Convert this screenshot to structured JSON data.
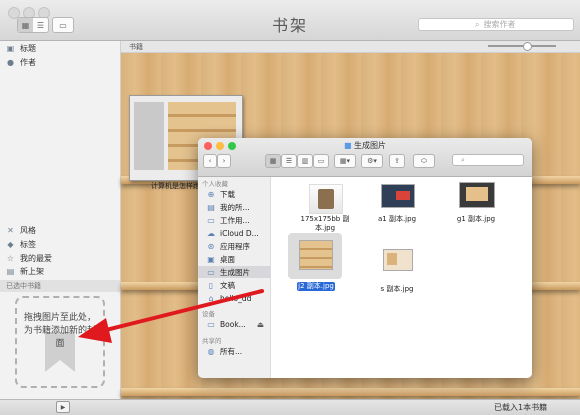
{
  "app": {
    "title": "书架"
  },
  "toolbar": {
    "view_grid_icon": "grid-view-icon",
    "view_list_icon": "list-view-icon",
    "view_cover_icon": "coverflow-view-icon",
    "search_placeholder": "搜索作者"
  },
  "sidebar": {
    "items": [
      {
        "label": "标题",
        "icon": "book-icon"
      },
      {
        "label": "作者",
        "icon": "person-icon"
      }
    ],
    "lower_items": [
      {
        "label": "风格",
        "icon": "tools-icon"
      },
      {
        "label": "标签",
        "icon": "tag-icon"
      },
      {
        "label": "我的最爱",
        "icon": "star-icon"
      },
      {
        "label": "新上架",
        "icon": "new-book-icon"
      }
    ],
    "selected_header": "已选中书籍",
    "drop_hint": "拖拽图片至此处，为书籍添加新的封面"
  },
  "main": {
    "column_header": "书籍",
    "book_label": "计算机是怎样跑起来的"
  },
  "bottom": {
    "status": "已载入1本书籍"
  },
  "finder": {
    "title": "生成图片",
    "sidebar": {
      "favorites_header": "个人收藏",
      "favorites": [
        {
          "label": "下载",
          "icon": "download-icon"
        },
        {
          "label": "我的所...",
          "icon": "files-icon"
        },
        {
          "label": "工作用...",
          "icon": "folder-icon"
        },
        {
          "label": "iCloud D...",
          "icon": "cloud-icon"
        },
        {
          "label": "应用程序",
          "icon": "apps-icon"
        },
        {
          "label": "桌面",
          "icon": "desktop-icon"
        },
        {
          "label": "生成图片",
          "icon": "folder-icon",
          "selected": true
        },
        {
          "label": "文稿",
          "icon": "document-icon"
        },
        {
          "label": "hello_dd",
          "icon": "home-icon"
        }
      ],
      "devices_header": "设备",
      "devices": [
        {
          "label": "Book...",
          "icon": "disk-icon"
        }
      ],
      "shared_header": "共享的",
      "shared": [
        {
          "label": "所有...",
          "icon": "network-icon"
        }
      ]
    },
    "files": [
      {
        "name": "175x175bb 副本.jpg"
      },
      {
        "name": "a1 副本.jpg"
      },
      {
        "name": "g1 副本.jpg"
      },
      {
        "name": "j2 副本.jpg",
        "selected": true
      },
      {
        "name": "s 副本.jpg"
      }
    ]
  },
  "colors": {
    "arrow": "#e0191e",
    "selection": "#2768d6",
    "folder": "#5c9be8"
  }
}
